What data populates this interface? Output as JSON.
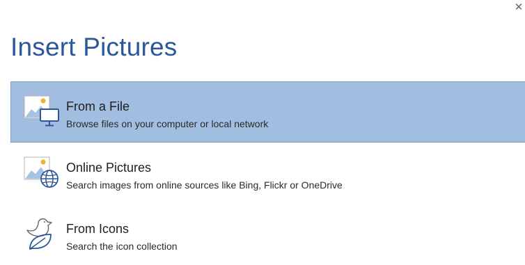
{
  "dialog": {
    "title": "Insert Pictures",
    "close_symbol": "✕"
  },
  "options": [
    {
      "label": "From a File",
      "description": "Browse files on your computer or local network",
      "icon": "picture-computer-icon",
      "selected": true
    },
    {
      "label": "Online Pictures",
      "description": "Search images from online sources like Bing, Flickr or OneDrive",
      "icon": "picture-globe-icon",
      "selected": false
    },
    {
      "label": "From Icons",
      "description": "Search the icon collection",
      "icon": "bird-leaf-icon",
      "selected": false
    }
  ],
  "colors": {
    "accent": "#2b579a",
    "selected_bg": "#a1bde0",
    "selected_border": "#7e9fcc",
    "icon_blue": "#2b579a",
    "icon_light_blue": "#a7c3e3",
    "icon_sun": "#f0b03c"
  }
}
